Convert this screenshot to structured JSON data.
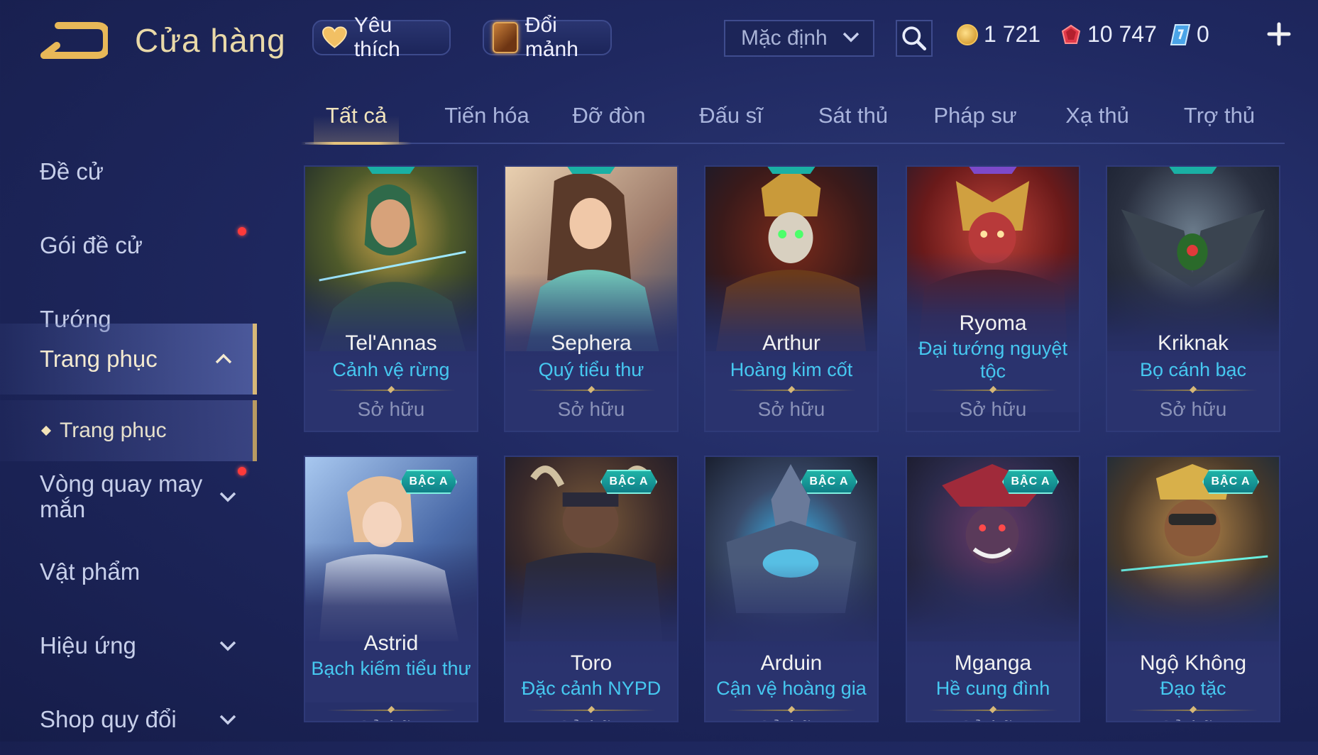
{
  "header": {
    "title": "Cửa hàng",
    "favorite_label": "Yêu thích",
    "fragment_label": "Đổi mảnh",
    "sort_selected": "Mặc định",
    "currencies": [
      {
        "icon": "gold-coin-icon",
        "value": "1 721"
      },
      {
        "icon": "ruby-icon",
        "value": "10 747"
      },
      {
        "icon": "voucher-icon",
        "value": "0"
      }
    ]
  },
  "sidebar": {
    "items": [
      {
        "label": "Đề cử"
      },
      {
        "label": "Gói đề cử",
        "dot": true
      },
      {
        "label": "Tướng"
      },
      {
        "label": "Trang phục",
        "active": true
      },
      {
        "label": "Vòng quay may mắn",
        "dot": true
      },
      {
        "label": "Vật phẩm"
      },
      {
        "label": "Hiệu ứng"
      },
      {
        "label": "Shop quy đổi"
      }
    ],
    "sub_item": "Trang phục"
  },
  "tabs": [
    "Tất cả",
    "Tiến hóa",
    "Đỡ đòn",
    "Đấu sĩ",
    "Sát thủ",
    "Pháp sư",
    "Xạ thủ",
    "Trợ thủ"
  ],
  "active_tab": "Tất cả",
  "cards": [
    {
      "hero": "Tel'Annas",
      "skin": "Cảnh vệ rừng",
      "status": "Sở hữu"
    },
    {
      "hero": "Sephera",
      "skin": "Quý tiểu thư",
      "status": "Sở hữu"
    },
    {
      "hero": "Arthur",
      "skin": "Hoàng kim cốt",
      "status": "Sở hữu"
    },
    {
      "hero": "Ryoma",
      "skin": "Đại tướng nguyệt tộc",
      "status": "Sở hữu"
    },
    {
      "hero": "Kriknak",
      "skin": "Bọ cánh bạc",
      "status": "Sở hữu"
    },
    {
      "hero": "Astrid",
      "skin": "Bạch kiếm tiểu thư",
      "status": "Sở hữu",
      "badge": "BẬC A"
    },
    {
      "hero": "Toro",
      "skin": "Đặc cảnh NYPD",
      "status": "Sở hữu",
      "badge": "BẬC A"
    },
    {
      "hero": "Arduin",
      "skin": "Cận vệ hoàng gia",
      "status": "Sở hữu",
      "badge": "BẬC A"
    },
    {
      "hero": "Mganga",
      "skin": "Hề cung đình",
      "status": "Sở hữu",
      "badge": "BẬC A"
    },
    {
      "hero": "Ngộ Không",
      "skin": "Đạo tặc",
      "status": "Sở hữu",
      "badge": "BẬC A"
    }
  ],
  "colors": {
    "accent_gold": "#e6c47d",
    "skin_name_blue": "#46c8f0",
    "badge_teal": "#1fb3a7",
    "red_dot": "#ff3a3a"
  }
}
